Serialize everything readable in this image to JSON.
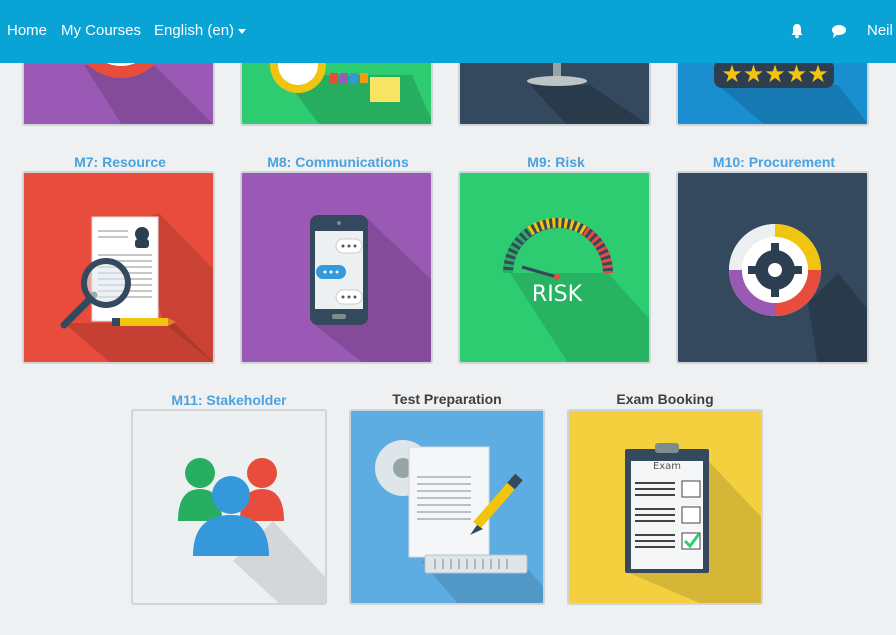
{
  "nav": {
    "home": "Home",
    "courses": "My Courses",
    "language": "English (en)",
    "user": "Neil",
    "icons": [
      "bell-icon",
      "chat-icon"
    ]
  },
  "courses": [
    {
      "title": "M7: Resource",
      "color": "#e84c3d",
      "icon": "resume-magnifier-icon"
    },
    {
      "title": "M8: Communications",
      "color": "#9b59b6",
      "icon": "phone-chat-icon"
    },
    {
      "title": "M9: Risk",
      "color": "#2ecc71",
      "icon": "risk-gauge-icon"
    },
    {
      "title": "M10: Procurement",
      "color": "#34495e",
      "icon": "gear-cycle-icon"
    },
    {
      "title": "M11: Stakeholder",
      "color": "#ecf0f1",
      "icon": "people-group-icon"
    },
    {
      "title": "Test Preparation",
      "color": "#5dade2",
      "icon": "document-pen-icon"
    },
    {
      "title": "Exam Booking",
      "color": "#f4d03f",
      "icon": "exam-clipboard-icon"
    }
  ],
  "exam_label": "Exam",
  "risk_label": "RISK",
  "top_row_colors": [
    "#9b59b6",
    "#2ecc71",
    "#34495e",
    "#1a8fd0"
  ]
}
